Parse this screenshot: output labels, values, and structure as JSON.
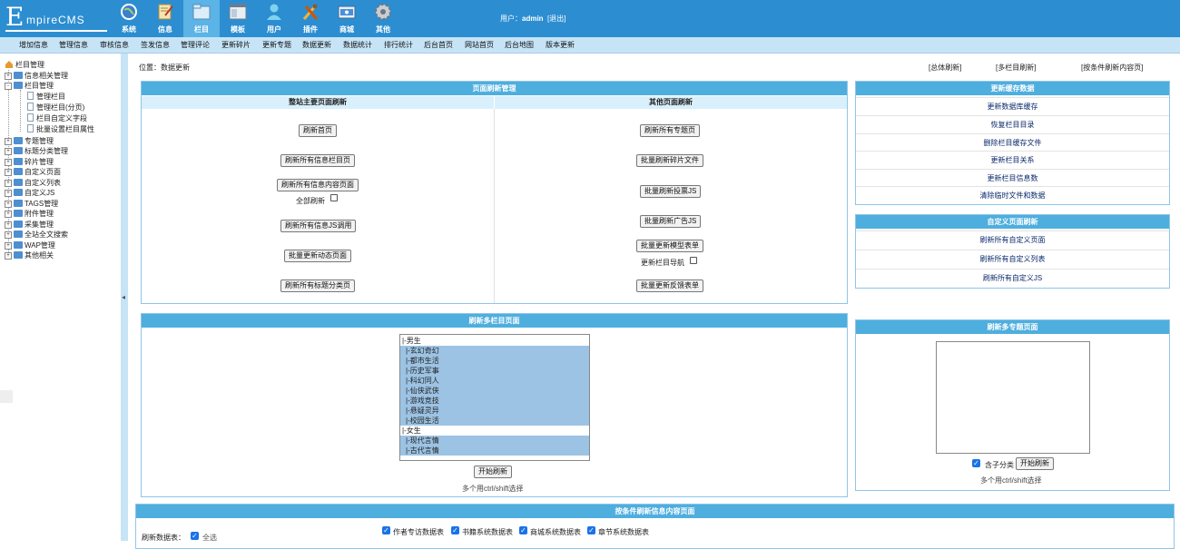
{
  "header": {
    "logo_big": "E",
    "logo_small": "mpireCMS",
    "nav": [
      {
        "label": "系统",
        "icon": "globe-icon"
      },
      {
        "label": "信息",
        "icon": "document-icon"
      },
      {
        "label": "栏目",
        "icon": "folder-icon"
      },
      {
        "label": "模板",
        "icon": "template-icon"
      },
      {
        "label": "用户",
        "icon": "user-icon"
      },
      {
        "label": "插件",
        "icon": "tools-icon"
      },
      {
        "label": "商城",
        "icon": "shop-icon"
      },
      {
        "label": "其他",
        "icon": "gear-icon"
      }
    ],
    "user_prefix": "用户：",
    "user_name": "admin",
    "logout": "[退出]"
  },
  "menubar": [
    "增加信息",
    "管理信息",
    "审核信息",
    "签发信息",
    "管理评论",
    "更新碎片",
    "更新专题",
    "数据更新",
    "数据统计",
    "排行统计",
    "后台首页",
    "网站首页",
    "后台地图",
    "版本更新"
  ],
  "tree": {
    "root": "栏目管理",
    "items": [
      {
        "label": "信息相关管理",
        "type": "folder",
        "sign": "+"
      },
      {
        "label": "栏目管理",
        "type": "folder",
        "sign": "-"
      },
      {
        "label": "管理栏目",
        "type": "doc"
      },
      {
        "label": "管理栏目(分页)",
        "type": "doc"
      },
      {
        "label": "栏目自定义字段",
        "type": "doc"
      },
      {
        "label": "批量设置栏目属性",
        "type": "doc"
      },
      {
        "label": "专题管理",
        "type": "folder",
        "sign": "+"
      },
      {
        "label": "标题分类管理",
        "type": "folder",
        "sign": "+"
      },
      {
        "label": "碎片管理",
        "type": "folder",
        "sign": "+"
      },
      {
        "label": "自定义页面",
        "type": "folder",
        "sign": "+"
      },
      {
        "label": "自定义列表",
        "type": "folder",
        "sign": "+"
      },
      {
        "label": "自定义JS",
        "type": "folder",
        "sign": "+"
      },
      {
        "label": "TAGS管理",
        "type": "folder",
        "sign": "+"
      },
      {
        "label": "附件管理",
        "type": "folder",
        "sign": "+"
      },
      {
        "label": "采集管理",
        "type": "folder",
        "sign": "+"
      },
      {
        "label": "全站全文搜索",
        "type": "folder",
        "sign": "+"
      },
      {
        "label": "WAP管理",
        "type": "folder",
        "sign": "+"
      },
      {
        "label": "其他相关",
        "type": "folder",
        "sign": "+"
      }
    ]
  },
  "splitter_arrow": "◂",
  "crumb": "位置：数据更新",
  "toplinks": [
    "[总体刷新]",
    "[多栏目刷新]",
    "[按条件刷新内容页]"
  ],
  "page_refresh": {
    "title": "页面刷新管理",
    "left_head": "整站主要页面刷新",
    "right_head": "其他页面刷新",
    "left_buttons": [
      "刷新首页",
      "刷新所有信息栏目页",
      "刷新所有信息内容页面",
      "刷新所有信息JS调用",
      "批量更新动态页面",
      "刷新所有标题分类页"
    ],
    "full_refresh_label": "全部刷新",
    "right_buttons": [
      "刷新所有专题页",
      "批量刷新碎片文件",
      "批量刷新投票JS",
      "批量刷新广告JS",
      "批量更新模型表单",
      "批量更新反馈表单"
    ],
    "nav_update_label": "更新栏目导航"
  },
  "cache": {
    "title": "更新缓存数据",
    "rows": [
      "更新数据库缓存",
      "恢复栏目目录",
      "删除栏目缓存文件",
      "更新栏目关系",
      "更新栏目信息数",
      "清除临时文件和数据"
    ]
  },
  "custom_refresh": {
    "title": "自定义页面刷新",
    "rows": [
      "刷新所有自定义页面",
      "刷新所有自定义列表",
      "刷新所有自定义JS"
    ]
  },
  "multi_class": {
    "title": "刷新多栏目页面",
    "options": [
      {
        "label": "|-男生",
        "sel": false
      },
      {
        "label": "|-玄幻奇幻",
        "sel": true
      },
      {
        "label": "|-都市生活",
        "sel": true
      },
      {
        "label": "|-历史军事",
        "sel": true
      },
      {
        "label": "|-科幻同人",
        "sel": true
      },
      {
        "label": "|-仙侠武侠",
        "sel": true
      },
      {
        "label": "|-游戏竞技",
        "sel": true
      },
      {
        "label": "|-悬疑灵异",
        "sel": true
      },
      {
        "label": "|-校园生活",
        "sel": true
      },
      {
        "label": "|-女生",
        "sel": false
      },
      {
        "label": "|-现代言情",
        "sel": true
      },
      {
        "label": "|-古代言情",
        "sel": true
      }
    ],
    "button": "开始刷新",
    "hint": "多个用ctrl/shift选择"
  },
  "multi_zt": {
    "title": "刷新多专题页面",
    "sub_label": "含子分类",
    "button": "开始刷新",
    "hint": "多个用ctrl/shift选择"
  },
  "cond_refresh": {
    "title": "按条件刷新信息内容页面",
    "table_label": "刷新数据表：",
    "select_all": "全选",
    "tables": [
      "作者专访数据表",
      "书籍系统数据表",
      "商城系统数据表",
      "章节系统数据表"
    ]
  }
}
